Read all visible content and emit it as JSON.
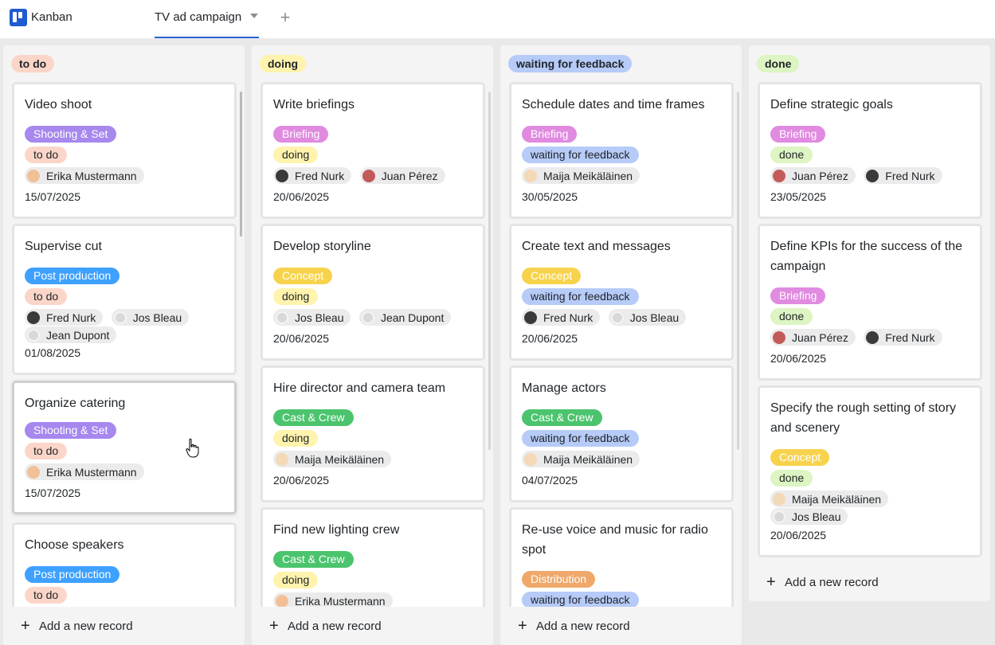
{
  "app": {
    "name": "Kanban",
    "logo_icon": "kanban-logo-icon"
  },
  "view_tab": {
    "label": "TV ad campaign",
    "caret_icon": "chevron-down-icon",
    "add_icon": "plus-icon"
  },
  "colors": {
    "shooting": "#a688ee",
    "post": "#3ea1ff",
    "briefing": "#e08ae0",
    "concept": "#f7d34d",
    "cast": "#4bc46d",
    "distribution": "#efa86a",
    "todo": "#fbd6c8",
    "doing": "#fff3ad",
    "waiting": "#b6cbf8",
    "done": "#dcf5c2"
  },
  "add_record_label": "Add a new record",
  "columns": [
    {
      "title": "to do",
      "cards": [
        {
          "title": "Video shoot",
          "tag": "Shooting & Set",
          "status": "to do",
          "people": [
            "Erika Mustermann"
          ],
          "date": "15/07/2025"
        },
        {
          "title": "Supervise cut",
          "tag": "Post production",
          "status": "to do",
          "people": [
            "Fred Nurk",
            "Jos Bleau",
            "Jean Dupont"
          ],
          "date": "01/08/2025"
        },
        {
          "title": "Organize catering",
          "tag": "Shooting & Set",
          "status": "to do",
          "people": [
            "Erika Mustermann"
          ],
          "date": "15/07/2025"
        },
        {
          "title": "Choose speakers",
          "tag": "Post production",
          "status": "to do",
          "people": [],
          "date": ""
        }
      ]
    },
    {
      "title": "doing",
      "cards": [
        {
          "title": "Write briefings",
          "tag": "Briefing",
          "status": "doing",
          "people": [
            "Fred Nurk",
            "Juan Pérez"
          ],
          "date": "20/06/2025"
        },
        {
          "title": "Develop storyline",
          "tag": "Concept",
          "status": "doing",
          "people": [
            "Jos Bleau",
            "Jean Dupont"
          ],
          "date": "20/06/2025"
        },
        {
          "title": "Hire director and camera team",
          "tag": "Cast & Crew",
          "status": "doing",
          "people": [
            "Maija Meikäläinen"
          ],
          "date": "20/06/2025"
        },
        {
          "title": "Find new lighting crew",
          "tag": "Cast & Crew",
          "status": "doing",
          "people": [
            "Erika Mustermann"
          ],
          "date": ""
        }
      ]
    },
    {
      "title": "waiting for feedback",
      "cards": [
        {
          "title": "Schedule dates and time frames",
          "tag": "Briefing",
          "status": "waiting for feedback",
          "people": [
            "Maija Meikäläinen"
          ],
          "date": "30/05/2025"
        },
        {
          "title": "Create text and messages",
          "tag": "Concept",
          "status": "waiting for feedback",
          "people": [
            "Fred Nurk",
            "Jos Bleau"
          ],
          "date": "20/06/2025"
        },
        {
          "title": "Manage actors",
          "tag": "Cast & Crew",
          "status": "waiting for feedback",
          "people": [
            "Maija Meikäläinen"
          ],
          "date": "04/07/2025"
        },
        {
          "title": "Re-use voice and music for radio spot",
          "tag": "Distribution",
          "status": "waiting for feedback",
          "people": [],
          "date": ""
        }
      ]
    },
    {
      "title": "done",
      "cards": [
        {
          "title": "Define strategic goals",
          "tag": "Briefing",
          "status": "done",
          "people": [
            "Juan Pérez",
            "Fred Nurk"
          ],
          "date": "23/05/2025"
        },
        {
          "title": "Define KPIs for the success of the campaign",
          "tag": "Briefing",
          "status": "done",
          "people": [
            "Juan Pérez",
            "Fred Nurk"
          ],
          "date": "20/06/2025"
        },
        {
          "title": "Specify the rough setting of story and scenery",
          "tag": "Concept",
          "status": "done",
          "people": [
            "Maija Meikäläinen",
            "Jos Bleau"
          ],
          "date": "20/06/2025"
        }
      ]
    }
  ]
}
